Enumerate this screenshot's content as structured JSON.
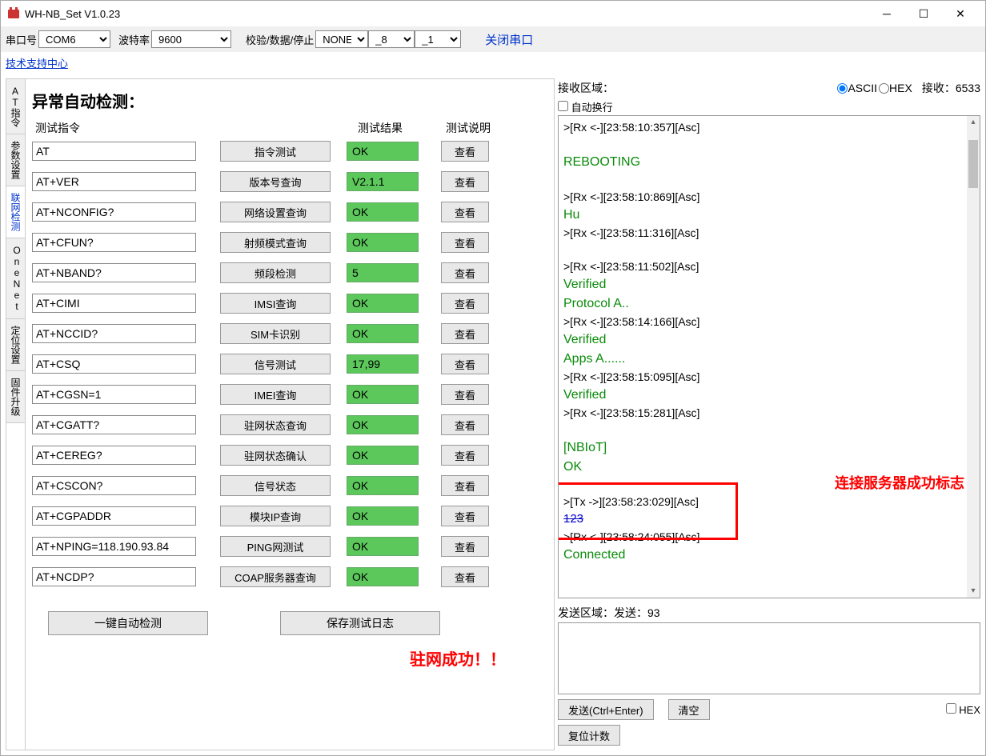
{
  "title": "WH-NB_Set V1.0.23",
  "toolbar": {
    "port_label": "串口号",
    "port_value": "COM6",
    "baud_label": "波特率",
    "baud_value": "9600",
    "parity_label": "校验/数据/停止",
    "parity_value": "NONE",
    "data_bits": "_8",
    "stop_bits": "_1",
    "close_port": "关闭串口"
  },
  "support_link": "技术支持中心",
  "vtabs": [
    "AT指令",
    "参数设置",
    "联网检测",
    "OneNet",
    "定位设置",
    "固件升级"
  ],
  "heading": "异常自动检测：",
  "col_headers": {
    "cmd": "测试指令",
    "btn": "",
    "res": "测试结果",
    "view": "测试说明"
  },
  "rows": [
    {
      "cmd": "AT",
      "btn": "指令测试",
      "res": "OK",
      "view": "查看"
    },
    {
      "cmd": "AT+VER",
      "btn": "版本号查询",
      "res": "V2.1.1",
      "view": "查看"
    },
    {
      "cmd": "AT+NCONFIG?",
      "btn": "网络设置查询",
      "res": "OK",
      "view": "查看"
    },
    {
      "cmd": "AT+CFUN?",
      "btn": "射频模式查询",
      "res": "OK",
      "view": "查看"
    },
    {
      "cmd": "AT+NBAND?",
      "btn": "频段检测",
      "res": "5",
      "view": "查看"
    },
    {
      "cmd": "AT+CIMI",
      "btn": "IMSI查询",
      "res": "OK",
      "view": "查看"
    },
    {
      "cmd": "AT+NCCID?",
      "btn": "SIM卡识别",
      "res": "OK",
      "view": "查看"
    },
    {
      "cmd": "AT+CSQ",
      "btn": "信号测试",
      "res": "17,99",
      "view": "查看"
    },
    {
      "cmd": "AT+CGSN=1",
      "btn": "IMEI查询",
      "res": "OK",
      "view": "查看"
    },
    {
      "cmd": "AT+CGATT?",
      "btn": "驻网状态查询",
      "res": "OK",
      "view": "查看"
    },
    {
      "cmd": "AT+CEREG?",
      "btn": "驻网状态确认",
      "res": "OK",
      "view": "查看"
    },
    {
      "cmd": "AT+CSCON?",
      "btn": "信号状态",
      "res": "OK",
      "view": "查看"
    },
    {
      "cmd": "AT+CGPADDR",
      "btn": "模块IP查询",
      "res": "OK",
      "view": "查看"
    },
    {
      "cmd": "AT+NPING=118.190.93.84",
      "btn": "PING网测试",
      "res": "OK",
      "view": "查看"
    },
    {
      "cmd": "AT+NCDP?",
      "btn": "COAP服务器查询",
      "res": "OK",
      "view": "查看"
    }
  ],
  "auto_detect_btn": "一键自动检测",
  "save_log_btn": "保存测试日志",
  "red_msg": "驻网成功！！",
  "rx": {
    "label": "接收区域：",
    "ascii": "ASCII",
    "hex": "HEX",
    "count_label": "接收：",
    "count": "6533",
    "autowrap": "自动换行"
  },
  "log_lines": [
    {
      "t": "rx",
      "v": ">[Rx <-][23:58:10:357][Asc]"
    },
    {
      "t": "sp"
    },
    {
      "t": "green",
      "v": "REBOOTING"
    },
    {
      "t": "sp"
    },
    {
      "t": "rx",
      "v": ">[Rx <-][23:58:10:869][Asc]"
    },
    {
      "t": "green",
      "v": "Hu"
    },
    {
      "t": "rx",
      "v": ">[Rx <-][23:58:11:316][Asc]"
    },
    {
      "t": "sp"
    },
    {
      "t": "rx",
      "v": ">[Rx <-][23:58:11:502][Asc]"
    },
    {
      "t": "green",
      "v": "Verified"
    },
    {
      "t": "green",
      "v": "Protocol A.."
    },
    {
      "t": "rx",
      "v": ">[Rx <-][23:58:14:166][Asc]"
    },
    {
      "t": "green",
      "v": "Verified"
    },
    {
      "t": "green",
      "v": "Apps A......"
    },
    {
      "t": "rx",
      "v": ">[Rx <-][23:58:15:095][Asc]"
    },
    {
      "t": "green",
      "v": "Verified"
    },
    {
      "t": "rx",
      "v": ">[Rx <-][23:58:15:281][Asc]"
    },
    {
      "t": "sp"
    },
    {
      "t": "green",
      "v": "[NBIoT]"
    },
    {
      "t": "green",
      "v": "OK"
    },
    {
      "t": "sp"
    },
    {
      "t": "rx",
      "v": ">[Tx ->][23:58:23:029][Asc]"
    },
    {
      "t": "blue",
      "v": "123"
    },
    {
      "t": "rx",
      "v": ">[Rx <-][23:58:24:055][Asc]"
    },
    {
      "t": "green",
      "v": "Connected"
    }
  ],
  "red_anno": "连接服务器成功标志",
  "tx": {
    "label": "发送区域：",
    "count_label": "发送：",
    "count": "93",
    "send_btn": "发送(Ctrl+Enter)",
    "clear_btn": "清空",
    "reset_btn": "复位计数",
    "hex": "HEX"
  }
}
